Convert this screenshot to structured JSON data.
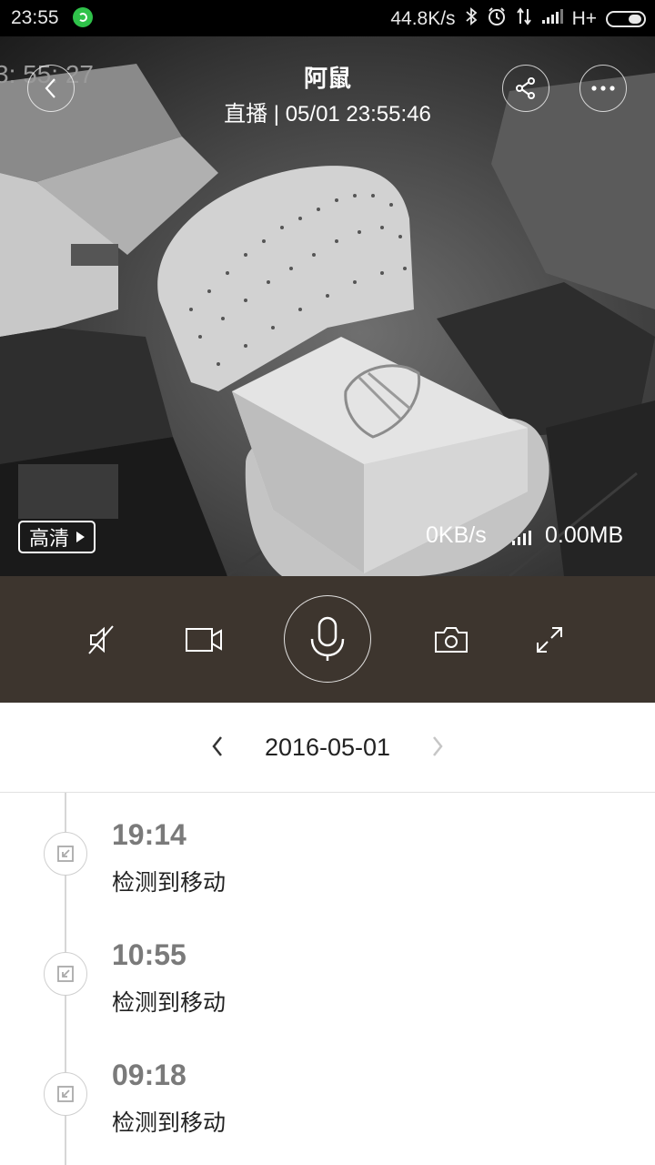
{
  "status_bar": {
    "time": "23:55",
    "net_speed": "44.8K/s",
    "network_type": "H+",
    "icons": [
      "whatsapp-icon",
      "bluetooth-icon",
      "alarm-icon",
      "data-arrows-icon",
      "signal-icon",
      "battery-icon"
    ]
  },
  "video": {
    "osd_timestamp": "3: 55: 27",
    "title": "阿鼠",
    "subtitle": "直播 | 05/01 23:55:46",
    "quality_label": "高清",
    "bitrate": "0KB/s",
    "data_used": "0.00MB"
  },
  "controls": {
    "buttons": [
      "mute-icon",
      "record-video-icon",
      "microphone-icon",
      "camera-snapshot-icon",
      "fullscreen-icon"
    ]
  },
  "date_nav": {
    "date": "2016-05-01"
  },
  "events": [
    {
      "time": "19:14",
      "description": "检测到移动"
    },
    {
      "time": "10:55",
      "description": "检测到移动"
    },
    {
      "time": "09:18",
      "description": "检测到移动"
    }
  ],
  "colors": {
    "control_bar": "#3d352e",
    "status_bar": "#000000",
    "event_time": "#7a7a7a"
  }
}
